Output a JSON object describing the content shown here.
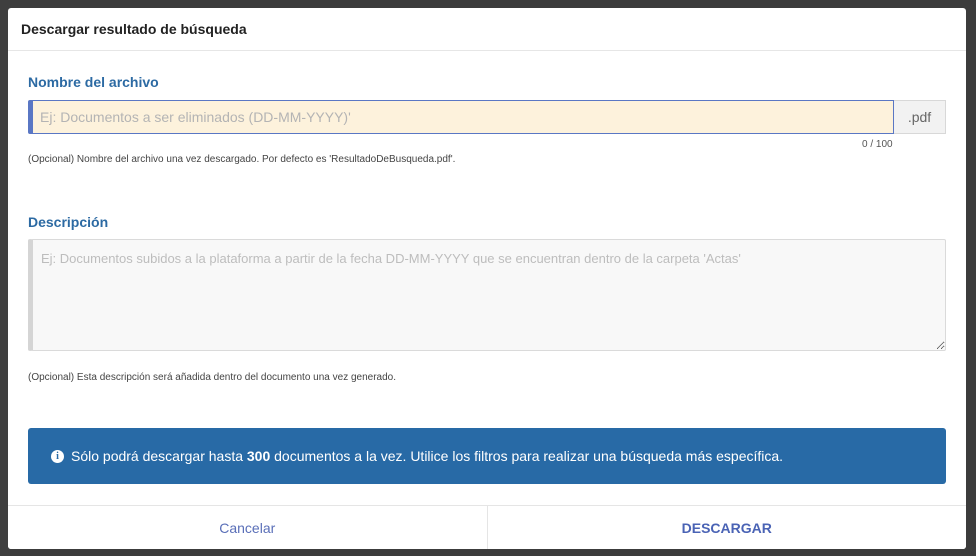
{
  "dialog": {
    "title": "Descargar resultado de búsqueda"
  },
  "filename": {
    "label": "Nombre del archivo",
    "placeholder": "Ej: Documentos a ser eliminados (DD-MM-YYYY)'",
    "value": "",
    "suffix": ".pdf",
    "counter": "0 / 100",
    "help": "(Opcional) Nombre del archivo una vez descargado. Por defecto es 'ResultadoDeBusqueda.pdf'."
  },
  "description": {
    "label": "Descripción",
    "placeholder": "Ej: Documentos subidos a la plataforma a partir de la fecha DD-MM-YYYY que se encuentran dentro de la carpeta 'Actas'",
    "value": "",
    "help": "(Opcional) Esta descripción será añadida dentro del documento una vez generado."
  },
  "banner": {
    "icon": "info-icon",
    "text_before": "Sólo podrá descargar hasta ",
    "limit": "300",
    "text_after": " documentos a la vez. Utilice los filtros para realizar una búsqueda más específica.",
    "color": "#286aa6"
  },
  "footer": {
    "cancel_label": "Cancelar",
    "download_label": "DESCARGAR"
  }
}
